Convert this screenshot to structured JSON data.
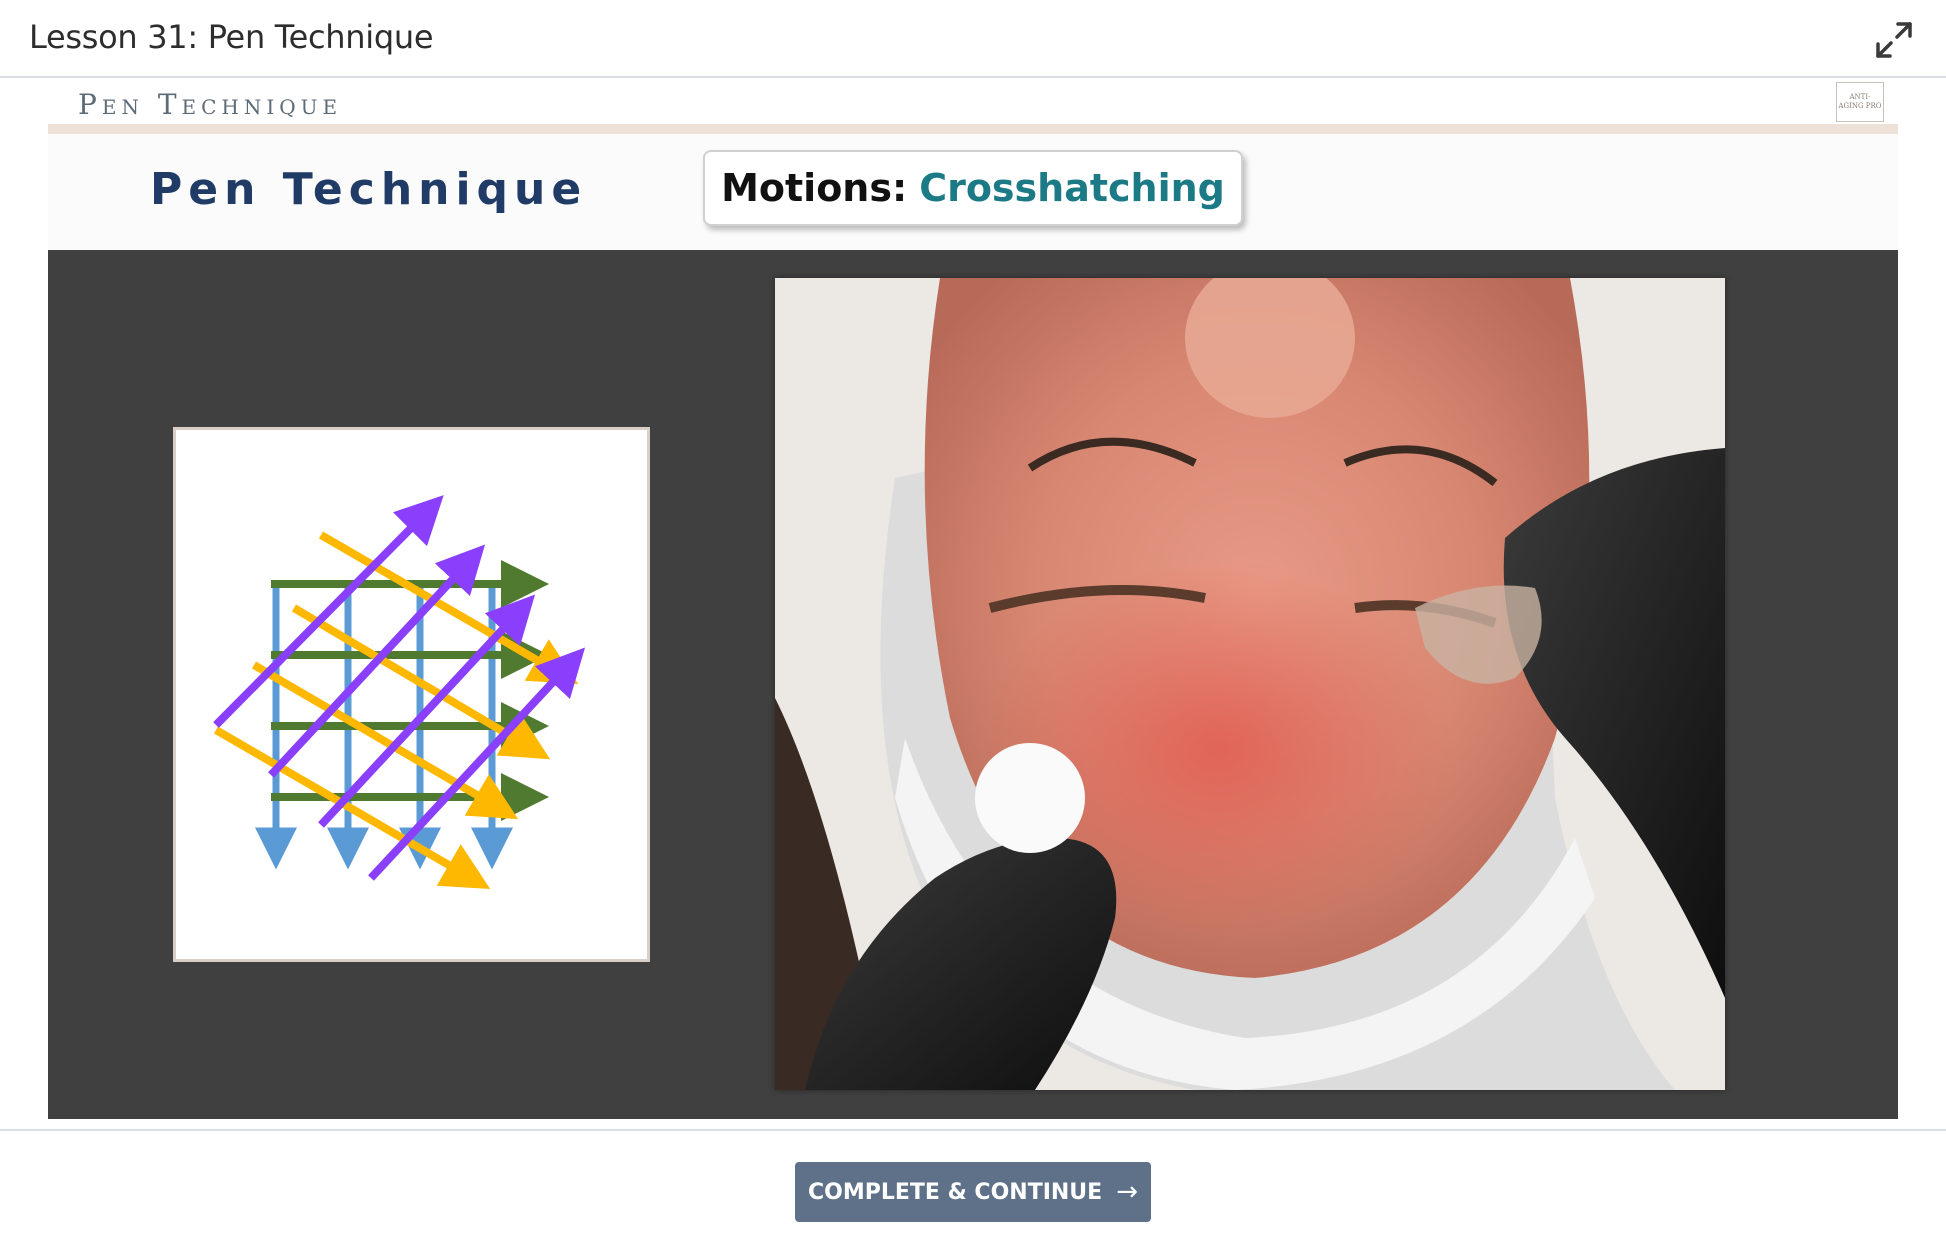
{
  "lesson": {
    "title": "Lesson 31: Pen Technique"
  },
  "toolbar": {
    "expand_icon": "expand-arrows-icon"
  },
  "slide": {
    "header_text": "Pen Technique",
    "logo_text": "ANTI-AGING PRO",
    "main_title": "Pen Technique",
    "motions_label": "Motions:",
    "motions_value": "Crosshatching",
    "diagram_colors": {
      "vertical": "#5b9bd5",
      "horizontal": "#4f7a2f",
      "diagonal_down": "#ffb800",
      "diagonal_up": "#8a3ffc"
    }
  },
  "footer": {
    "cta_label": "COMPLETE & CONTINUE",
    "cta_icon": "arrow-right-icon"
  }
}
